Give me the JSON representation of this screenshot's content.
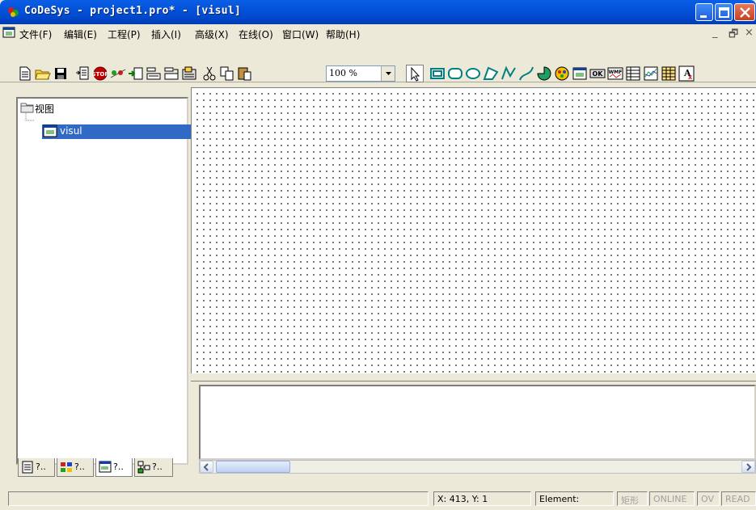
{
  "window": {
    "title": "CoDeSys - project1.pro* - [visul]",
    "minimize_icon": "minimize-icon",
    "maximize_icon": "maximize-icon",
    "close_icon": "close-icon"
  },
  "menubar": {
    "items": [
      {
        "label": "文件(F)"
      },
      {
        "label": "编辑(E)"
      },
      {
        "label": "工程(P)"
      },
      {
        "label": "插入(I)"
      },
      {
        "label": "高级(X)"
      },
      {
        "label": "在线(O)"
      },
      {
        "label": "窗口(W)"
      },
      {
        "label": "帮助(H)"
      }
    ],
    "mdi_minimize": "_",
    "mdi_restore": "🗗",
    "mdi_close": "×"
  },
  "toolbar": {
    "zoom_value": "100 %"
  },
  "tree": {
    "root_label": "视图",
    "child_label": "visul"
  },
  "tabs": [
    {
      "label": "?.."
    },
    {
      "label": "?.."
    },
    {
      "label": "?.."
    },
    {
      "label": "?.."
    }
  ],
  "statusbar": {
    "coords": "X:   413, Y:    1",
    "element": "Element:",
    "mode": "矩形",
    "online": "ONLINE",
    "ov": "OV",
    "read": "READ"
  },
  "colors": {
    "title_bar": "#0352d8",
    "selection": "#316ac5",
    "chrome": "#ece9d8"
  }
}
